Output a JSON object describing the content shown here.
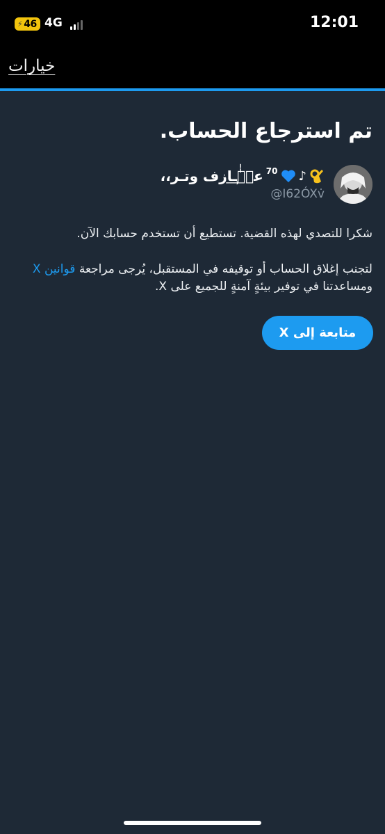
{
  "status_bar": {
    "battery_level": "46",
    "network": "4G",
    "time": "12:01"
  },
  "header": {
    "options_label": "خيارات",
    "accent_color": "#1d9bf0"
  },
  "main": {
    "title": "تم استرجاع الحساب.",
    "profile": {
      "display_name": "ﻋ۪ہٰٰـ͢ازف وتـر،،",
      "superscript": "70",
      "music_note": "♪",
      "handle": "@I62ÓXv̇",
      "icons": [
        "avatar",
        "blue-heart-icon",
        "music-note-icon",
        "ok-hand-icon"
      ]
    },
    "paragraph1": "شكرا للتصدي لهذه القضية. تستطيع أن تستخدم حسابك الآن.",
    "paragraph2_before_link": "لتجنب إغلاق الحساب أو توقيفه في المستقبل، يُرجى مراجعة ",
    "paragraph2_link": "قوانين X",
    "paragraph2_after_link": " ومساعدتنا في توفير بيئةٍ آمنةٍ للجميع على X.",
    "continue_button": "متابعة إلى X"
  },
  "colors": {
    "background": "#1e2936",
    "header": "#000000",
    "link": "#1d9bf0",
    "handle": "#8b98a5"
  }
}
